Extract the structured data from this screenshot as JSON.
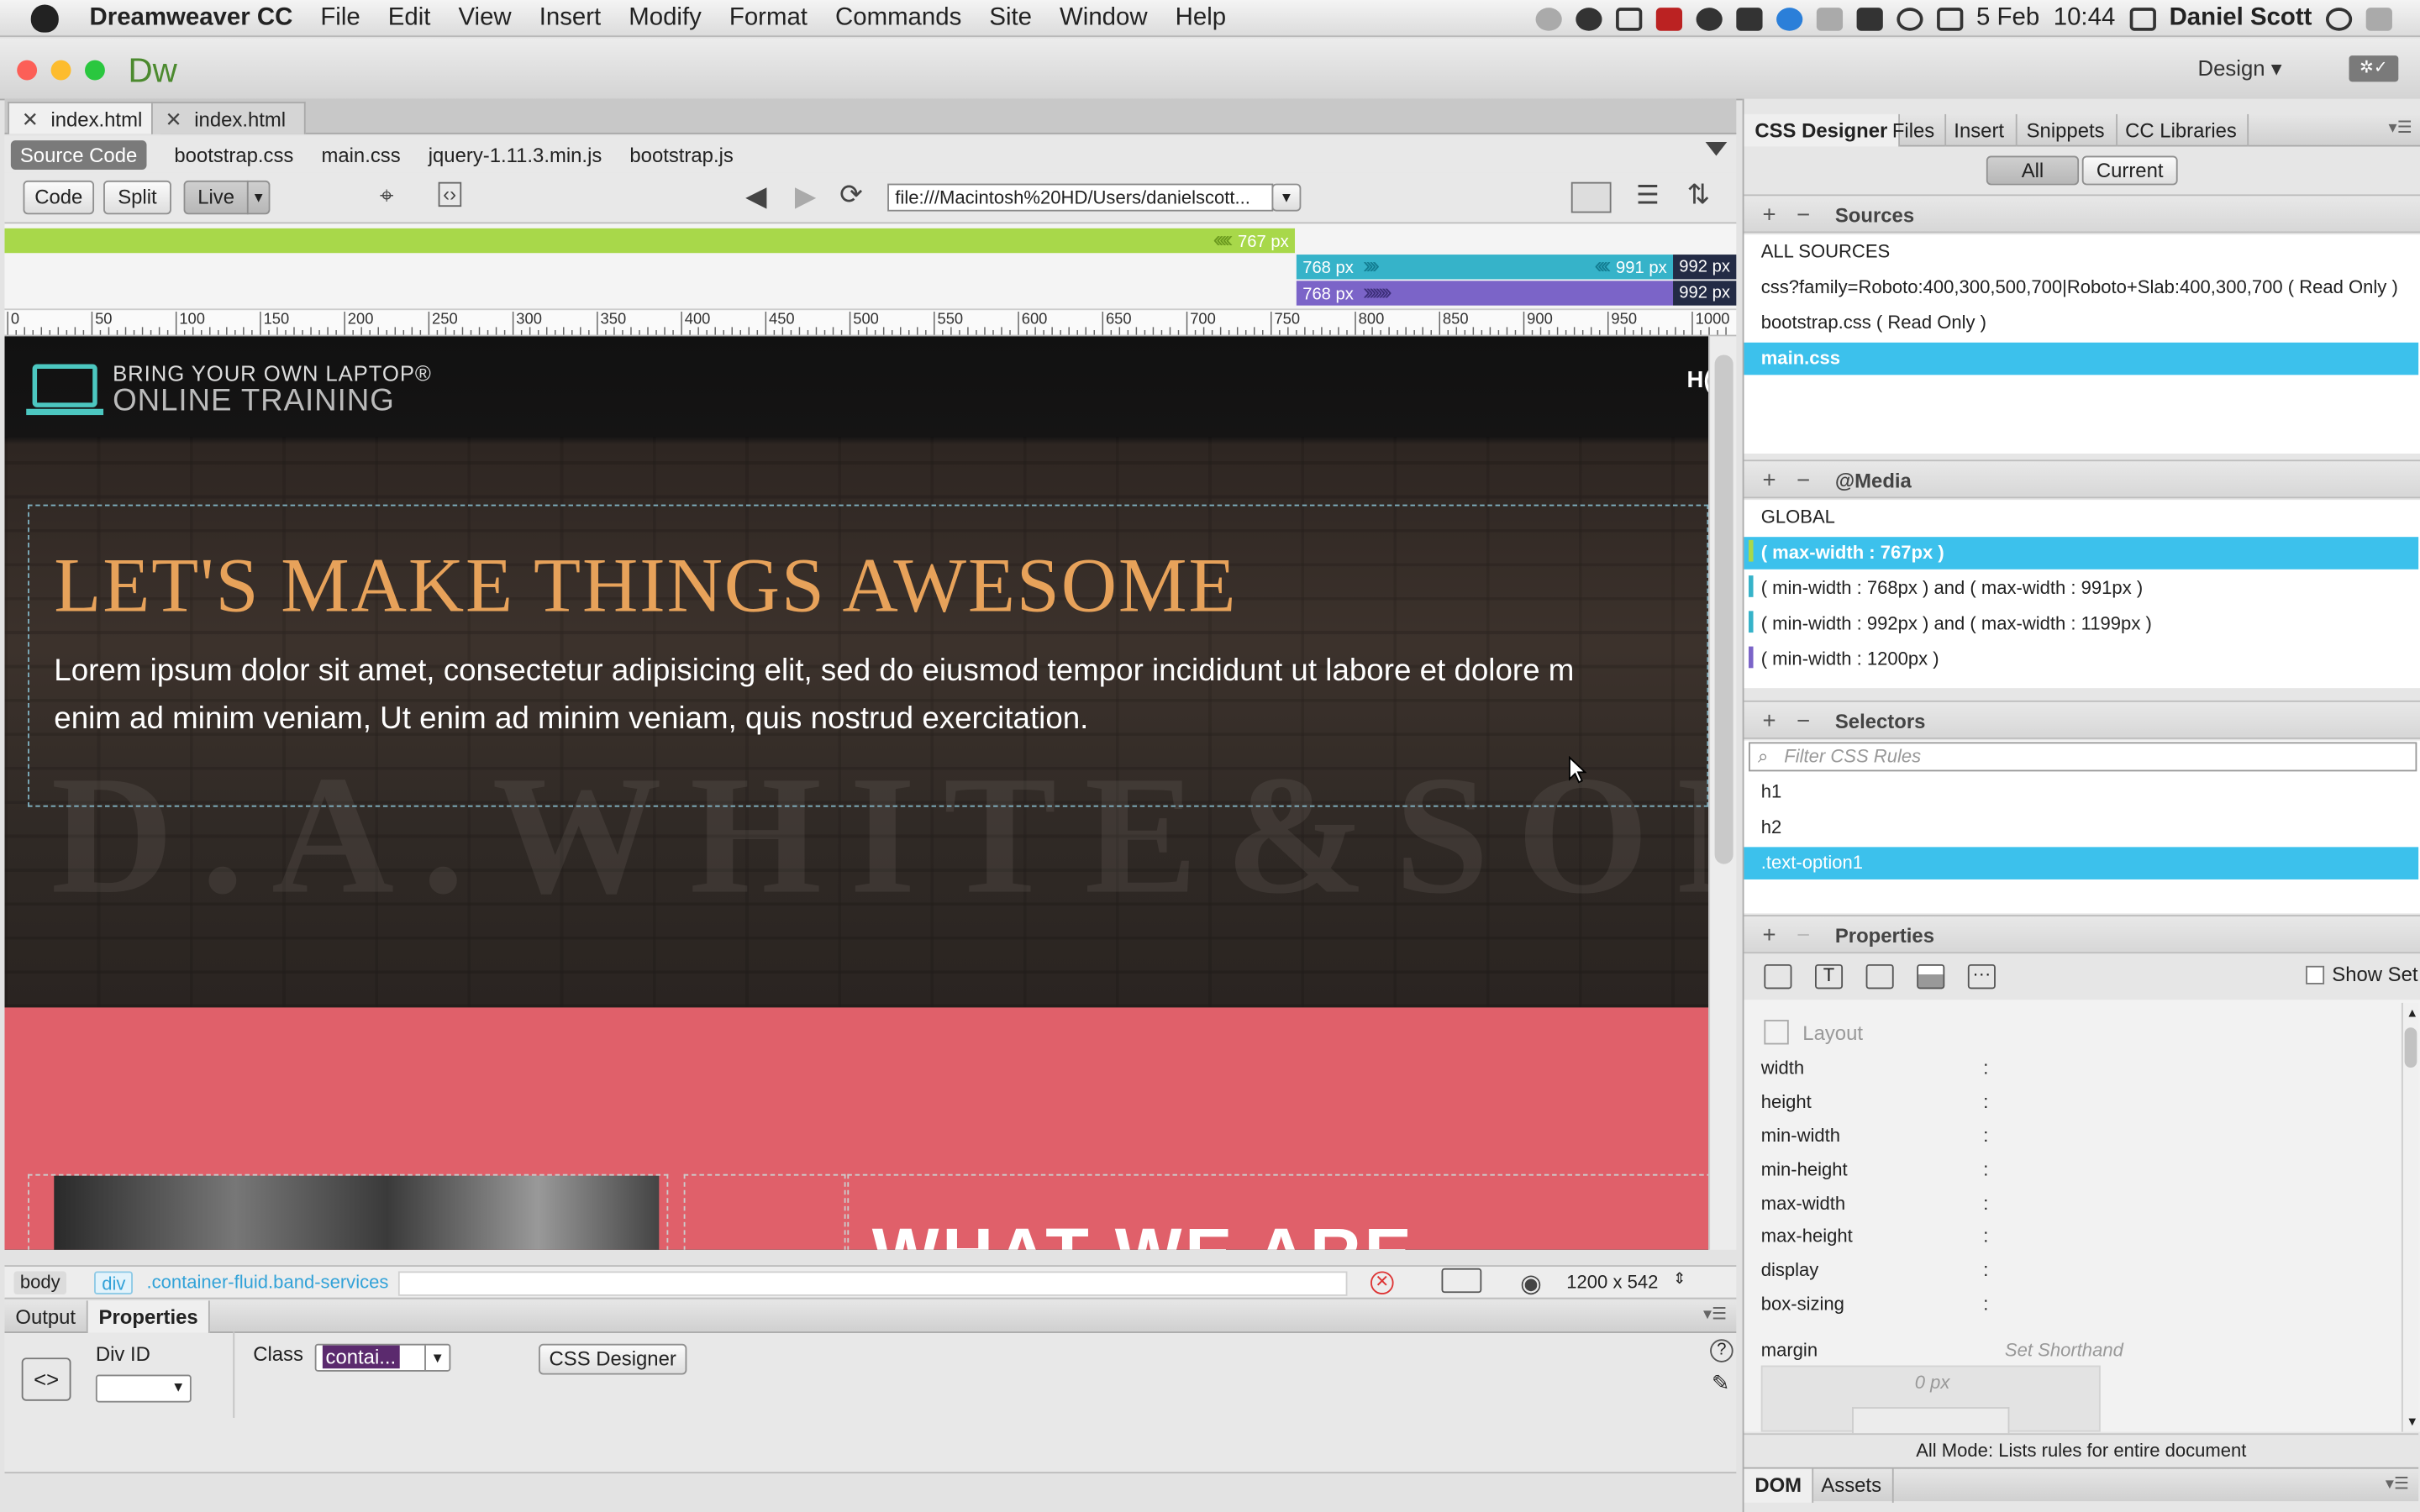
{
  "menubar": {
    "app": "Dreamweaver CC",
    "items": [
      "File",
      "Edit",
      "View",
      "Insert",
      "Modify",
      "Format",
      "Commands",
      "Site",
      "Window",
      "Help"
    ],
    "date": "5 Feb",
    "time": "10:44",
    "user": "Daniel Scott"
  },
  "window": {
    "logo": "Dw",
    "workspace": "Design"
  },
  "doc_tabs": [
    "index.html",
    "index.html"
  ],
  "related_files": [
    "Source Code",
    "bootstrap.css",
    "main.css",
    "jquery-1.11.3.min.js",
    "bootstrap.js"
  ],
  "toolbar": {
    "code": "Code",
    "split": "Split",
    "live": "Live",
    "url": "file:///Macintosh%20HD/Users/danielscott..."
  },
  "media_bars": {
    "bar1": "767  px",
    "bar2_start": "768  px",
    "bar2_end": "991  px",
    "bar2_tail": "992  px",
    "bar3_start": "768  px",
    "bar3_tail": "992  px",
    "colors": {
      "green": "#a8d84a",
      "teal": "#36b3c9",
      "purple": "#7b64c8",
      "navy": "#232b45"
    }
  },
  "ruler_ticks": [
    "0",
    "50",
    "100",
    "150",
    "200",
    "250",
    "300",
    "350",
    "400",
    "450",
    "500",
    "550",
    "600",
    "650",
    "700",
    "750",
    "800",
    "850",
    "900",
    "950",
    "1000"
  ],
  "page": {
    "logo_line1": "BRING YOUR OWN LAPTOP®",
    "logo_line2": "ONLINE TRAINING",
    "nav_partial": "H(",
    "heading": "LET'S MAKE THINGS AWESOME",
    "lead_line1": "Lorem ipsum dolor sit amet, consectetur adipisicing elit, sed do eiusmod tempor incididunt ut labore et dolore m",
    "lead_line2": "enim ad minim veniam, Ut enim ad minim veniam, quis nostrud exercitation.",
    "section_heading": "WHAT WE ARE"
  },
  "tag_selector": {
    "body": "body",
    "div": "div",
    "class": ".container-fluid.band-services",
    "size": "1200 x 542"
  },
  "bottom_panel": {
    "tabs": [
      "Output",
      "Properties"
    ],
    "div_id_label": "Div ID",
    "class_label": "Class",
    "class_value": "contai...",
    "css_designer_btn": "CSS Designer"
  },
  "css_designer": {
    "tabs": [
      "CSS Designer",
      "Files",
      "Insert",
      "Snippets",
      "CC Libraries"
    ],
    "all": "All",
    "current": "Current",
    "sources_title": "Sources",
    "sources": [
      "ALL SOURCES",
      "css?family=Roboto:400,300,500,700|Roboto+Slab:400,300,700  ( Read Only )",
      "bootstrap.css  ( Read Only )",
      "main.css"
    ],
    "media_title": "@Media",
    "media": [
      "GLOBAL",
      "( max-width : 767px )",
      "( min-width : 768px ) and ( max-width : 991px )",
      "( min-width : 992px ) and ( max-width : 1199px )",
      "( min-width : 1200px )"
    ],
    "selectors_title": "Selectors",
    "filter_placeholder": "Filter CSS Rules",
    "selectors": [
      "h1",
      "h2",
      ".text-option1"
    ],
    "properties_title": "Properties",
    "show_set": "Show Set",
    "layout_label": "Layout",
    "props": [
      "width",
      "height",
      "min-width",
      "min-height",
      "max-width",
      "max-height",
      "display",
      "box-sizing"
    ],
    "margin": "margin",
    "set_shorthand": "Set Shorthand",
    "margin_value": "0 px",
    "status": "All Mode: Lists rules for entire document",
    "bottom_tabs": [
      "DOM",
      "Assets"
    ]
  }
}
